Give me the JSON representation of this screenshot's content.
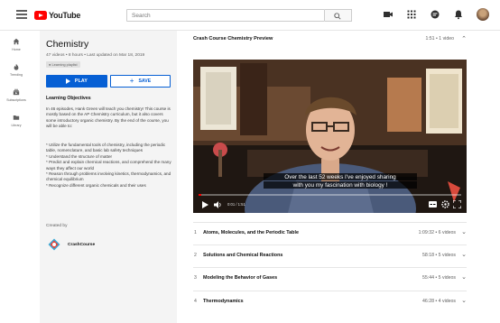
{
  "header": {
    "logo_text": "YouTube",
    "search_placeholder": "Search"
  },
  "nav": [
    {
      "label": "Home",
      "icon": "home-icon"
    },
    {
      "label": "Trending",
      "icon": "flame-icon"
    },
    {
      "label": "Subscriptions",
      "icon": "subscriptions-icon"
    },
    {
      "label": "Library",
      "icon": "folder-icon"
    }
  ],
  "playlist": {
    "title": "Chemistry",
    "meta": "47 videos • 8 hours • Last updated on Mar 18, 2019",
    "badge": "Learning playlist",
    "play_label": "PLAY",
    "save_label": "SAVE",
    "objectives_title": "Learning Objectives",
    "intro": "In 46 episodes, Hank Green will teach you chemistry! This course is mostly based on the AP Chemistry curriculum, but it also covers some introductory organic chemistry. By the end of the course, you will be able to:",
    "bullets": "* Utilize the fundamental tools of chemistry, including the periodic table, nomenclature, and basic lab safety techniques\n* Understand the structure of matter\n* Predict and explain chemical reactions, and comprehend the many ways they affect our world\n* Reason through problems involving kinetics, thermodynamics, and chemical equilibrium\n* Recognize different organic chemicals and their uses",
    "created_by_label": "Created by",
    "creator": "CrashCourse"
  },
  "preview": {
    "title": "Crash Course Chemistry Preview",
    "meta": "1:51 • 1 video",
    "caption_line1": "Over the last 52 weeks I've enjoyed sharing",
    "caption_line2": "with you my fascination with biology !",
    "time": "0:01 / 1:51",
    "progress": 0.01
  },
  "sections": [
    {
      "num": "1",
      "name": "Atoms, Molecules, and the Periodic Table",
      "meta": "1:09:32 • 6 videos"
    },
    {
      "num": "2",
      "name": "Solutions and Chemical Reactions",
      "meta": "58:18 • 5 videos"
    },
    {
      "num": "3",
      "name": "Modeling the Behavior of Gases",
      "meta": "55:44 • 5 videos"
    },
    {
      "num": "4",
      "name": "Thermodynamics",
      "meta": "46:28 • 4 videos"
    }
  ],
  "colors": {
    "accent_blue": "#065fd4",
    "brand_red": "#ff0000",
    "panel_bg": "#f4f4f4"
  }
}
